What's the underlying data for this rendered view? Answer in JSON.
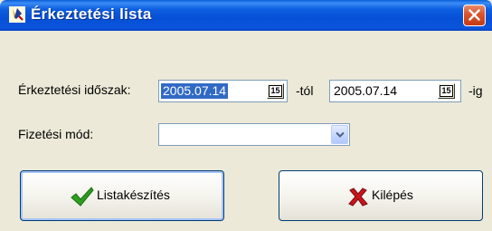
{
  "window": {
    "title": "Érkeztetési lista"
  },
  "form": {
    "period_label": "Érkeztetési időszak:",
    "date_from": "2005.07.14",
    "from_suffix": "-tól",
    "date_to": "2005.07.14",
    "to_suffix": "-ig",
    "calendar_glyph": "15",
    "payment_label": "Fizetési mód:",
    "payment_value": ""
  },
  "buttons": {
    "create_list": "Listakészítés",
    "exit": "Kilépés"
  },
  "icons": {
    "app": "pen-icon",
    "close": "close-icon",
    "calendar": "calendar-icon",
    "dropdown": "chevron-down-icon",
    "confirm": "checkmark-icon",
    "cancel": "x-icon"
  },
  "colors": {
    "titlebar": "#0a55dc",
    "selection": "#316ac5",
    "checkmark": "#2e9e20",
    "cross": "#c8141c",
    "close": "#d9532c"
  }
}
